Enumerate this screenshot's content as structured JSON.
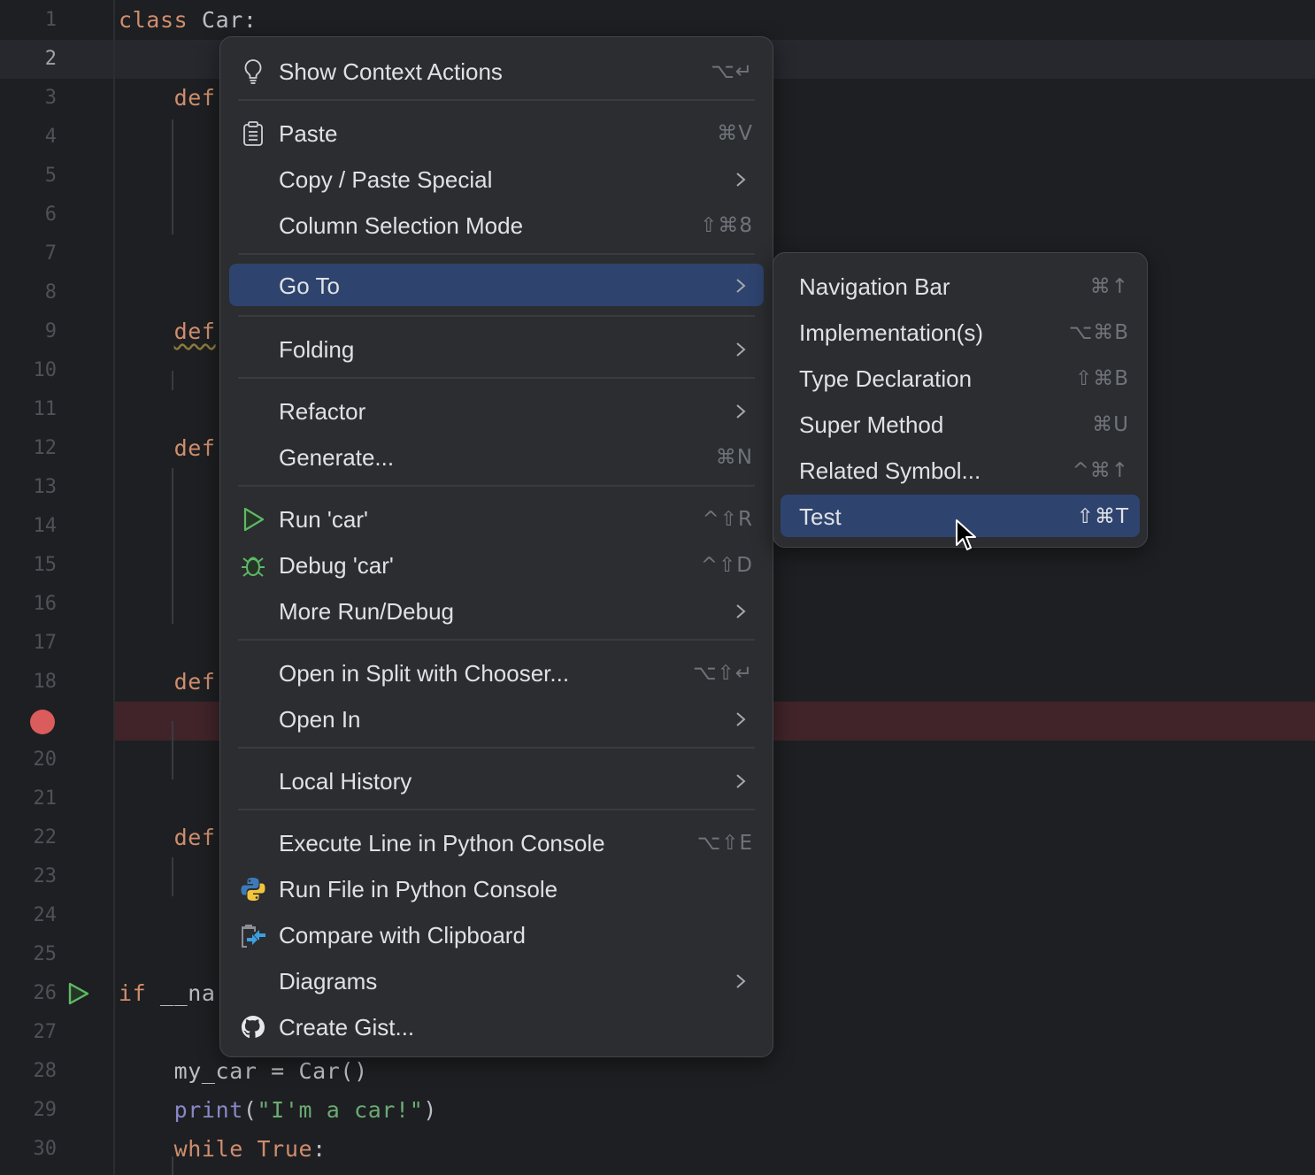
{
  "editor": {
    "current_line": 2,
    "breakpoint_line": 19,
    "lines": [
      {
        "n": "1",
        "tokens": [
          {
            "t": "class",
            "c": "kw"
          },
          {
            "t": " Car:"
          }
        ]
      },
      {
        "n": "2",
        "tokens": []
      },
      {
        "n": "3",
        "tokens": [
          {
            "t": "    "
          },
          {
            "t": "def",
            "c": "kw"
          }
        ]
      },
      {
        "n": "4",
        "tokens": []
      },
      {
        "n": "5",
        "tokens": []
      },
      {
        "n": "6",
        "tokens": []
      },
      {
        "n": "7",
        "tokens": []
      },
      {
        "n": "8",
        "tokens": []
      },
      {
        "n": "9",
        "tokens": [
          {
            "t": "    "
          },
          {
            "t": "def",
            "c": "kw squiggle"
          }
        ]
      },
      {
        "n": "10",
        "tokens": []
      },
      {
        "n": "11",
        "tokens": []
      },
      {
        "n": "12",
        "tokens": [
          {
            "t": "    "
          },
          {
            "t": "def",
            "c": "kw"
          }
        ]
      },
      {
        "n": "13",
        "tokens": []
      },
      {
        "n": "14",
        "tokens": []
      },
      {
        "n": "15",
        "tokens": []
      },
      {
        "n": "16",
        "tokens": []
      },
      {
        "n": "17",
        "tokens": []
      },
      {
        "n": "18",
        "tokens": [
          {
            "t": "    "
          },
          {
            "t": "def",
            "c": "kw"
          }
        ]
      },
      {
        "n": "",
        "tokens": []
      },
      {
        "n": "20",
        "tokens": []
      },
      {
        "n": "21",
        "tokens": []
      },
      {
        "n": "22",
        "tokens": [
          {
            "t": "    "
          },
          {
            "t": "def",
            "c": "kw"
          }
        ]
      },
      {
        "n": "23",
        "tokens": []
      },
      {
        "n": "24",
        "tokens": []
      },
      {
        "n": "25",
        "tokens": []
      },
      {
        "n": "26",
        "tokens": [
          {
            "t": "if",
            "c": "kw"
          },
          {
            "t": " __nar"
          }
        ]
      },
      {
        "n": "27",
        "tokens": []
      },
      {
        "n": "28",
        "tokens": [
          {
            "t": "    my_car = Car()"
          }
        ]
      },
      {
        "n": "29",
        "tokens": [
          {
            "t": "    "
          },
          {
            "t": "print",
            "c": "builtin"
          },
          {
            "t": "("
          },
          {
            "t": "\"I'm a car!\"",
            "c": "str"
          },
          {
            "t": ")"
          }
        ]
      },
      {
        "n": "30",
        "tokens": [
          {
            "t": "    "
          },
          {
            "t": "while",
            "c": "kw"
          },
          {
            "t": " "
          },
          {
            "t": "True",
            "c": "kw"
          },
          {
            "t": ":"
          }
        ]
      }
    ]
  },
  "context_menu": {
    "items": [
      {
        "label": "Show Context Actions",
        "shortcut": "⌥↵",
        "icon": "lightbulb-icon"
      },
      {
        "label": "Paste",
        "shortcut": "⌘V",
        "icon": "clipboard-icon"
      },
      {
        "label": "Copy / Paste Special",
        "submenu": true
      },
      {
        "label": "Column Selection Mode",
        "shortcut": "⇧⌘8"
      },
      {
        "label": "Go To",
        "submenu": true,
        "active": true
      },
      {
        "label": "Folding",
        "submenu": true
      },
      {
        "label": "Refactor",
        "submenu": true
      },
      {
        "label": "Generate...",
        "shortcut": "⌘N"
      },
      {
        "label": "Run 'car'",
        "shortcut": "^⇧R",
        "icon": "run-icon"
      },
      {
        "label": "Debug 'car'",
        "shortcut": "^⇧D",
        "icon": "debug-icon"
      },
      {
        "label": "More Run/Debug",
        "submenu": true
      },
      {
        "label": "Open in Split with Chooser...",
        "shortcut": "⌥⇧↵"
      },
      {
        "label": "Open In",
        "submenu": true
      },
      {
        "label": "Local History",
        "submenu": true
      },
      {
        "label": "Execute Line in Python Console",
        "shortcut": "⌥⇧E"
      },
      {
        "label": "Run File in Python Console",
        "icon": "python-icon"
      },
      {
        "label": "Compare with Clipboard",
        "icon": "compare-clipboard-icon"
      },
      {
        "label": "Diagrams",
        "submenu": true
      },
      {
        "label": "Create Gist...",
        "icon": "github-icon"
      }
    ]
  },
  "goto_submenu": {
    "items": [
      {
        "label": "Navigation Bar",
        "shortcut": "⌘↑"
      },
      {
        "label": "Implementation(s)",
        "shortcut": "⌥⌘B"
      },
      {
        "label": "Type Declaration",
        "shortcut": "⇧⌘B"
      },
      {
        "label": "Super Method",
        "shortcut": "⌘U"
      },
      {
        "label": "Related Symbol...",
        "shortcut": "^⌘↑"
      },
      {
        "label": "Test",
        "shortcut": "⇧⌘T",
        "active": true
      }
    ]
  },
  "colors": {
    "accent_selection": "#2e436e",
    "breakpoint": "#db5c5c",
    "run_green": "#5fb865"
  }
}
